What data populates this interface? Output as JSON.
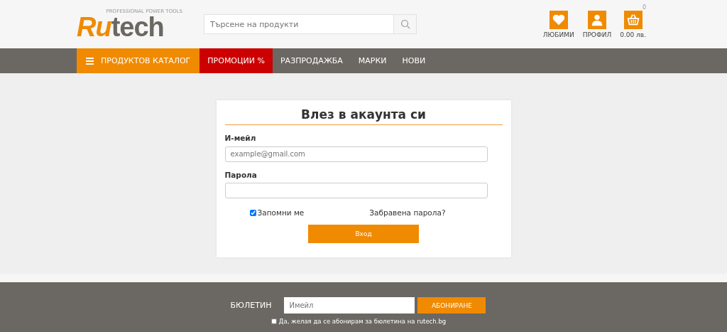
{
  "logo": {
    "first": "Ru",
    "rest": "tech",
    "tagline": "PROFESSIONAL POWER TOOLS"
  },
  "search": {
    "placeholder": "Търсене на продукти"
  },
  "header_actions": [
    {
      "kind": "heart",
      "label": "ЛЮБИМИ"
    },
    {
      "kind": "user",
      "label": "ПРОФИЛ"
    },
    {
      "kind": "cart",
      "label": "0.00 лв.",
      "badge": "0"
    }
  ],
  "nav": [
    {
      "kind": "catalog",
      "label": "ПРОДУКТОВ КАТАЛОГ"
    },
    {
      "kind": "promo",
      "label": "ПРОМОЦИИ %"
    },
    {
      "kind": "plain",
      "label": "РАЗПРОДАЖБА"
    },
    {
      "kind": "plain",
      "label": "МАРКИ"
    },
    {
      "kind": "plain",
      "label": "НОВИ"
    }
  ],
  "login": {
    "title": "Влез в акаунта си",
    "email_label": "И-мейл",
    "email_placeholder": "example@gmail.com",
    "password_label": "Парола",
    "remember": {
      "label": "Запомни ме",
      "checked": true
    },
    "forgot": "Забравена парола?",
    "submit": "Вход"
  },
  "newsletter": {
    "label": "БЮЛЕТИН",
    "placeholder": "Имейл",
    "button": "АБОНИРАНЕ",
    "consent": {
      "label": "Да, желая да се абонирам за бюлетина на rutech.bg",
      "checked": false
    }
  }
}
